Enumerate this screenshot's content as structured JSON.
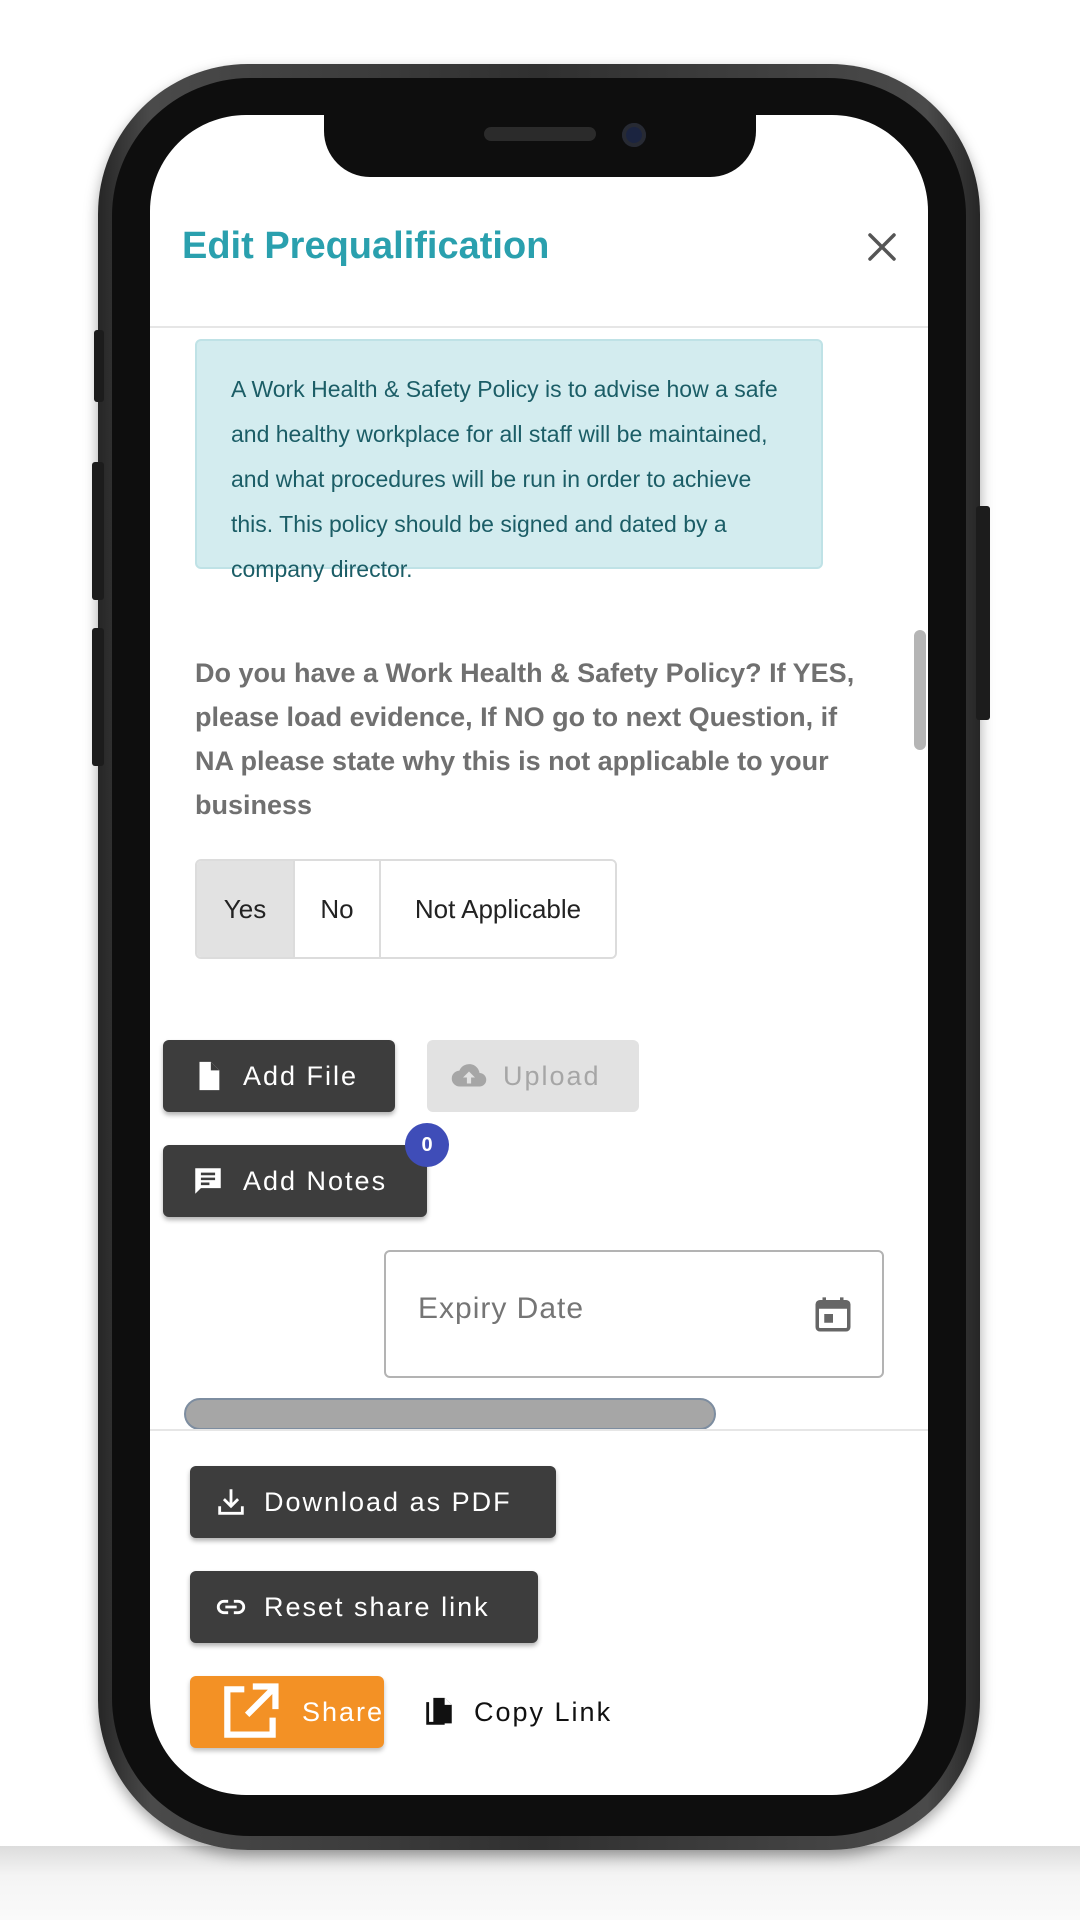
{
  "dialog": {
    "title": "Edit Prequalification",
    "close_label": "×"
  },
  "info_box": {
    "text": "A Work Health & Safety Policy is to advise how a safe and healthy workplace for all staff will be maintained, and what procedures will be run in order to achieve this. This policy should be signed and dated by a company director."
  },
  "question": {
    "text": "Do you have a Work Health & Safety Policy? If YES, please load evidence, If NO go to next Question, if NA please state why this is not applicable to your business"
  },
  "answer_options": [
    {
      "label": "Yes",
      "selected": true
    },
    {
      "label": "No",
      "selected": false
    },
    {
      "label": "Not Applicable",
      "selected": false
    }
  ],
  "actions": {
    "add_file": "Add File",
    "upload": "Upload",
    "add_notes": "Add Notes",
    "notes_count": "0"
  },
  "expiry": {
    "placeholder": "Expiry Date"
  },
  "footer": {
    "download_pdf": "Download as PDF",
    "reset_share_link": "Reset share link",
    "share": "Share",
    "copy_link": "Copy Link"
  },
  "colors": {
    "title": "#2aa0ae",
    "info_bg": "#d3ecef",
    "dark_button": "#3d3d3d",
    "share_button": "#f39125",
    "badge": "#3f4db8"
  },
  "icons": [
    "close-icon",
    "file-icon",
    "cloud-upload-icon",
    "notes-icon",
    "calendar-icon",
    "download-icon",
    "link-icon",
    "open-in-new-icon",
    "copy-icon"
  ]
}
